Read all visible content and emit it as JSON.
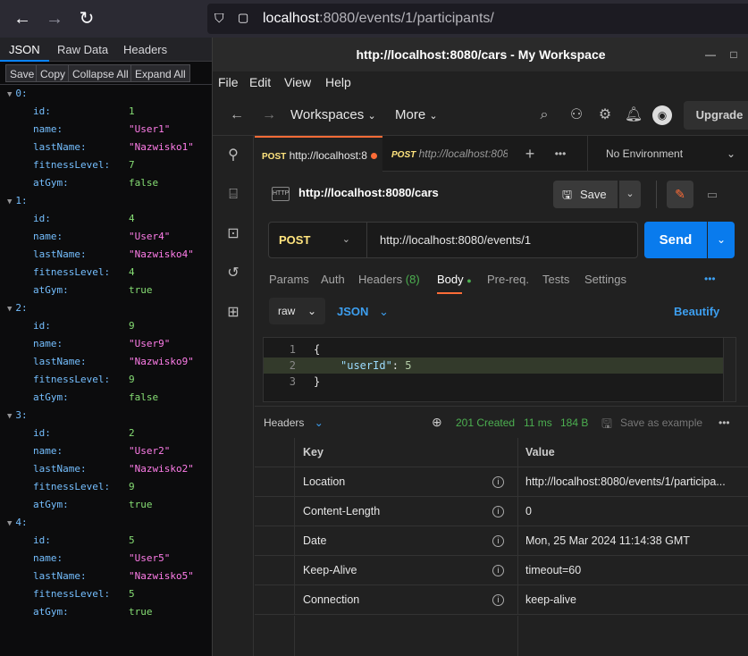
{
  "browser": {
    "url_host": "localhost",
    "url_rest": ":8080/events/1/participants/"
  },
  "json_viewer": {
    "tabs": [
      "JSON",
      "Raw Data",
      "Headers"
    ],
    "toolbar": [
      "Save",
      "Copy",
      "Collapse All",
      "Expand All"
    ],
    "items": [
      {
        "index": "0:",
        "id": "1",
        "name": "\"User1\"",
        "lastName": "\"Nazwisko1\"",
        "fitnessLevel": "7",
        "atGym": "false"
      },
      {
        "index": "1:",
        "id": "4",
        "name": "\"User4\"",
        "lastName": "\"Nazwisko4\"",
        "fitnessLevel": "4",
        "atGym": "true"
      },
      {
        "index": "2:",
        "id": "9",
        "name": "\"User9\"",
        "lastName": "\"Nazwisko9\"",
        "fitnessLevel": "9",
        "atGym": "false"
      },
      {
        "index": "3:",
        "id": "2",
        "name": "\"User2\"",
        "lastName": "\"Nazwisko2\"",
        "fitnessLevel": "9",
        "atGym": "true"
      },
      {
        "index": "4:",
        "id": "5",
        "name": "\"User5\"",
        "lastName": "\"Nazwisko5\"",
        "fitnessLevel": "5",
        "atGym": "true"
      }
    ],
    "keys": {
      "id": "id:",
      "name": "name:",
      "lastName": "lastName:",
      "fitnessLevel": "fitnessLevel:",
      "atGym": "atGym:"
    }
  },
  "postman": {
    "window_title": "http://localhost:8080/cars - My Workspace",
    "menu": [
      "File",
      "Edit",
      "View",
      "Help"
    ],
    "nav": {
      "workspaces": "Workspaces",
      "more": "More",
      "upgrade": "Upgrade"
    },
    "tabs": [
      {
        "method": "POST",
        "label": "http://localhost:8"
      },
      {
        "method": "POST",
        "label": "http://localhost:808"
      }
    ],
    "environment": "No Environment",
    "request_title": "http://localhost:8080/cars",
    "save_label": "Save",
    "method": "POST",
    "url": "http://localhost:8080/events/1",
    "send_label": "Send",
    "subtabs": {
      "params": "Params",
      "auth": "Auth",
      "headers": "Headers",
      "headers_count": "(8)",
      "body": "Body",
      "prereq": "Pre-req.",
      "tests": "Tests",
      "settings": "Settings"
    },
    "body_mode": "raw",
    "body_lang": "JSON",
    "beautify": "Beautify",
    "editor_lines": [
      "1",
      "2",
      "3"
    ],
    "editor": {
      "open": "{",
      "key": "\"userId\"",
      "colon": ": ",
      "value": "5",
      "close": "}"
    },
    "response": {
      "section": "Headers",
      "status": "201 Created",
      "time": "11 ms",
      "size": "184 B",
      "save_example": "Save as example"
    },
    "headers_table": {
      "col_key": "Key",
      "col_value": "Value",
      "rows": [
        {
          "key": "Location",
          "value": "http://localhost:8080/events/1/participa..."
        },
        {
          "key": "Content-Length",
          "value": "0"
        },
        {
          "key": "Date",
          "value": "Mon, 25 Mar 2024 11:14:38 GMT"
        },
        {
          "key": "Keep-Alive",
          "value": "timeout=60"
        },
        {
          "key": "Connection",
          "value": "keep-alive"
        }
      ]
    },
    "colors": {
      "accent": "#ff6c37",
      "send": "#097bed",
      "status_ok": "#4caf50",
      "method_post": "#ffe47e"
    }
  }
}
